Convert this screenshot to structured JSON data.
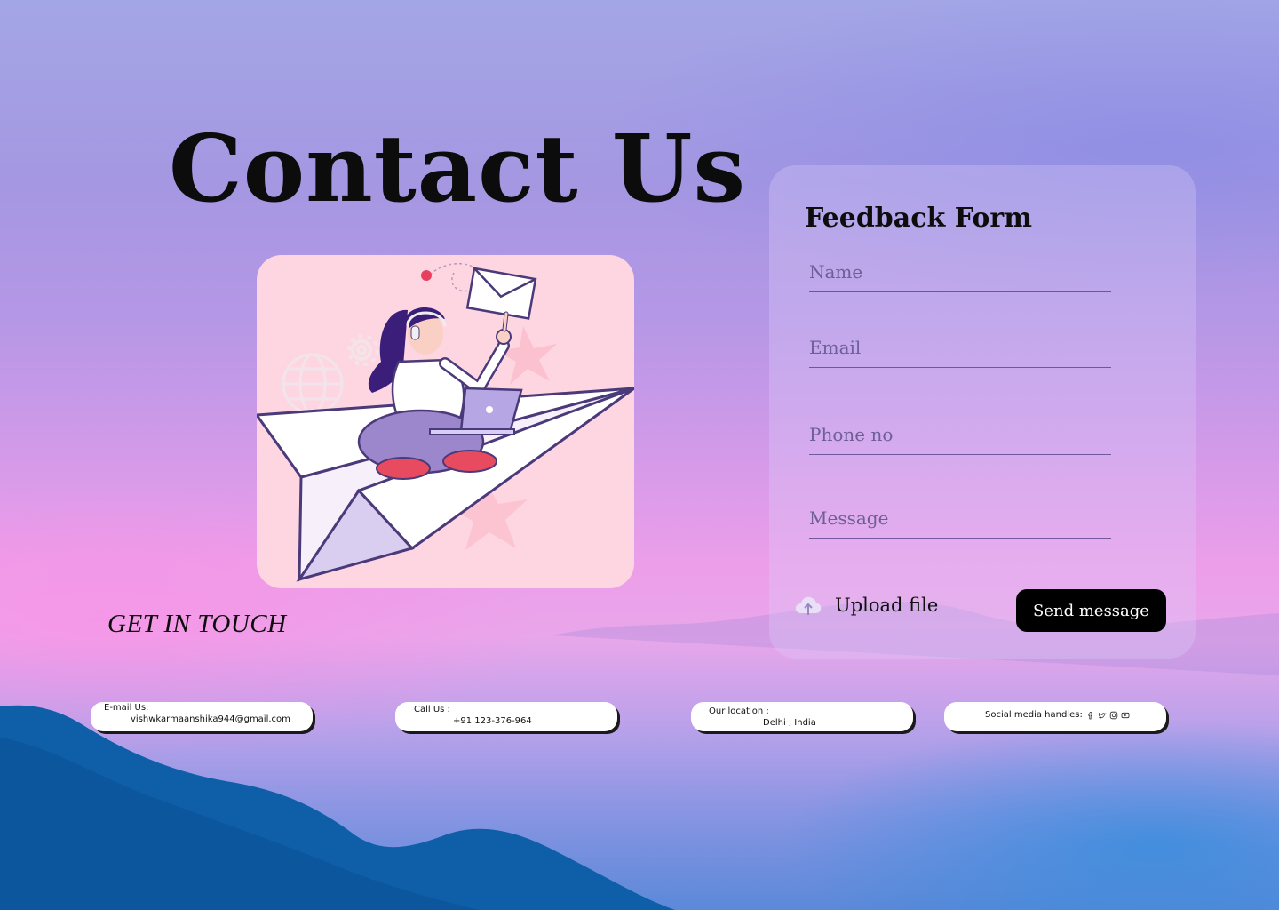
{
  "page": {
    "title": "Contact Us",
    "tagline": "GET IN TOUCH"
  },
  "illustration": {
    "icon": "paper-plane-support-illustration"
  },
  "form": {
    "title": "Feedback Form",
    "fields": {
      "name_placeholder": "Name",
      "email_placeholder": "Email",
      "phone_placeholder": "Phone no",
      "message_placeholder": "Message"
    },
    "upload_label": "Upload file",
    "upload_icon": "cloud-upload-icon",
    "submit_label": "Send message"
  },
  "contacts": {
    "email": {
      "label": "E-mail Us:",
      "value": "vishwkarmaanshika944@gmail.com"
    },
    "phone": {
      "label": "Call Us :",
      "value": "+91 123-376-964"
    },
    "location": {
      "label": "Our location :",
      "value": "Delhi , India"
    },
    "social": {
      "label": "Social media handles:",
      "icons": [
        "facebook-icon",
        "twitter-icon",
        "instagram-icon",
        "youtube-icon"
      ]
    }
  },
  "colors": {
    "accent": "#000000",
    "card": "#fdd6e2",
    "text": "#0d0d0d"
  }
}
